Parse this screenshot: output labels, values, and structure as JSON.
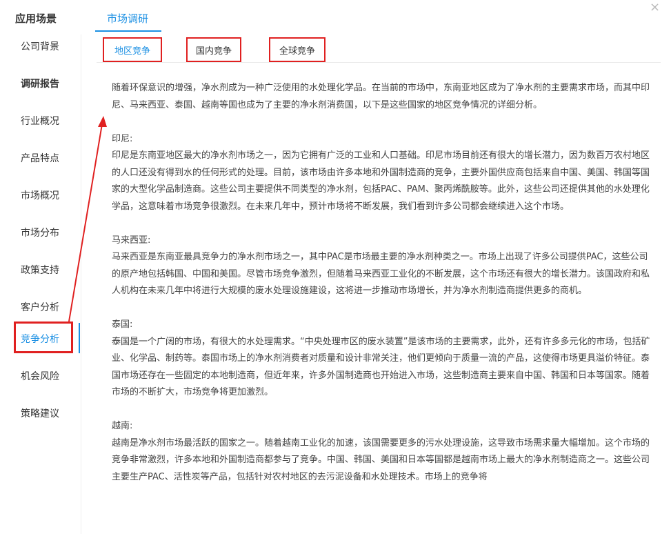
{
  "header": {
    "title": "应用场景",
    "top_tab": "市场调研",
    "close": "×"
  },
  "sidebar": {
    "items": [
      {
        "label": "公司背景"
      },
      {
        "label": "调研报告"
      },
      {
        "label": "行业概况"
      },
      {
        "label": "产品特点"
      },
      {
        "label": "市场概况"
      },
      {
        "label": "市场分布"
      },
      {
        "label": "政策支持"
      },
      {
        "label": "客户分析"
      },
      {
        "label": "竞争分析"
      },
      {
        "label": "机会风险"
      },
      {
        "label": "策略建议"
      }
    ]
  },
  "subtabs": [
    {
      "label": "地区竞争"
    },
    {
      "label": "国内竞争"
    },
    {
      "label": "全球竞争"
    }
  ],
  "content": {
    "intro": "随着环保意识的增强，净水剂成为一种广泛使用的水处理化学品。在当前的市场中，东南亚地区成为了净水剂的主要需求市场，而其中印尼、马来西亚、泰国、越南等国也成为了主要的净水剂消费国，以下是这些国家的地区竞争情况的详细分析。",
    "sections": [
      {
        "heading": "印尼:",
        "body": "印尼是东南亚地区最大的净水剂市场之一，因为它拥有广泛的工业和人口基础。印尼市场目前还有很大的增长潜力，因为数百万农村地区的人口还没有得到水的任何形式的处理。目前，该市场由许多本地和外国制造商的竞争，主要外国供应商包括来自中国、美国、韩国等国家的大型化学品制造商。这些公司主要提供不同类型的净水剂，包括PAC、PAM、聚丙烯酰胺等。此外，这些公司还提供其他的水处理化学品，这意味着市场竞争很激烈。在未来几年中，预计市场将不断发展，我们看到许多公司都会继续进入这个市场。"
      },
      {
        "heading": "马来西亚:",
        "body": "马来西亚是东南亚最具竞争力的净水剂市场之一，其中PAC是市场最主要的净水剂种类之一。市场上出现了许多公司提供PAC，这些公司的原产地包括韩国、中国和美国。尽管市场竞争激烈，但随着马来西亚工业化的不断发展，这个市场还有很大的增长潜力。该国政府和私人机构在未来几年中将进行大规模的废水处理设施建设，这将进一步推动市场增长，并为净水剂制造商提供更多的商机。"
      },
      {
        "heading": "泰国:",
        "body": "泰国是一个广阔的市场，有很大的水处理需求。“中央处理市区的废水装置”是该市场的主要需求，此外，还有许多多元化的市场，包括矿业、化学品、制药等。泰国市场上的净水剂消费者对质量和设计非常关注，他们更倾向于质量一流的产品，这使得市场更具溢价特征。泰国市场还存在一些固定的本地制造商，但近年来，许多外国制造商也开始进入市场，这些制造商主要来自中国、韩国和日本等国家。随着市场的不断扩大，市场竞争将更加激烈。"
      },
      {
        "heading": "越南:",
        "body": "越南是净水剂市场最活跃的国家之一。随着越南工业化的加速，该国需要更多的污水处理设施，这导致市场需求量大幅增加。这个市场的竞争非常激烈，许多本地和外国制造商都参与了竞争。中国、韩国、美国和日本等国都是越南市场上最大的净水剂制造商之一。这些公司主要生产PAC、活性炭等产品，包括针对农村地区的去污泥设备和水处理技术。市场上的竞争将"
      }
    ]
  },
  "colors": {
    "accent": "#1a8fe3",
    "highlight": "#e02020"
  }
}
